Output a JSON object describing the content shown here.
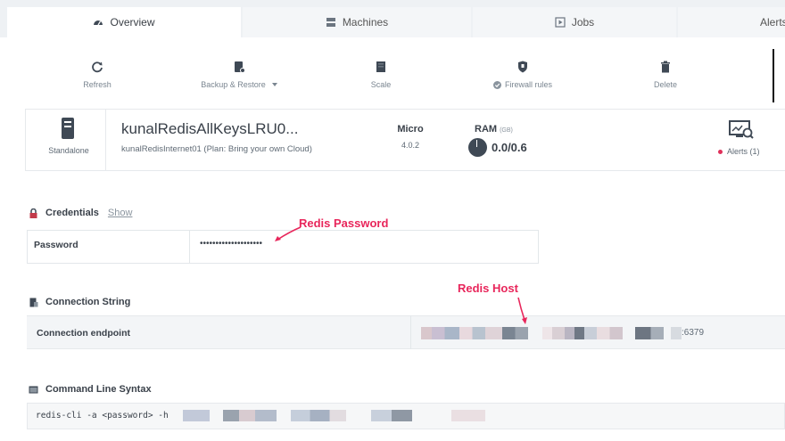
{
  "tabs": [
    {
      "label": "Overview",
      "icon": "dashboard-icon",
      "active": true
    },
    {
      "label": "Machines",
      "icon": "server-icon",
      "active": false
    },
    {
      "label": "Jobs",
      "icon": "play-icon",
      "active": false
    },
    {
      "label": "Alerts",
      "icon": "bell-icon",
      "active": false
    }
  ],
  "toolbar": {
    "refresh": "Refresh",
    "backup_restore": "Backup & Restore",
    "scale": "Scale",
    "firewall": "Firewall rules",
    "delete": "Delete"
  },
  "database": {
    "type": "Standalone",
    "name": "kunalRedisAllKeysLRU0...",
    "subtitle": "kunalRedisInternet01 (Plan: Bring your own Cloud)",
    "plan_title": "Micro",
    "plan_version": "4.0.2",
    "ram_label": "RAM",
    "ram_unit": "(GB)",
    "ram_value": "0.0/0.6",
    "alerts": "Alerts (1)"
  },
  "credentials": {
    "title": "Credentials",
    "show": "Show",
    "password_label": "Password",
    "password_value": "••••••••••••••••••••"
  },
  "connection": {
    "title": "Connection String",
    "endpoint_label": "Connection endpoint",
    "port": ":6379"
  },
  "cli": {
    "title": "Command Line Syntax",
    "command": "redis-cli -a <password> -h"
  },
  "annotations": {
    "password": "Redis Password",
    "host": "Redis Host"
  },
  "colors": {
    "accent": "#e8265b",
    "icon": "#3f4955",
    "tab_bg": "#eef1f4"
  }
}
